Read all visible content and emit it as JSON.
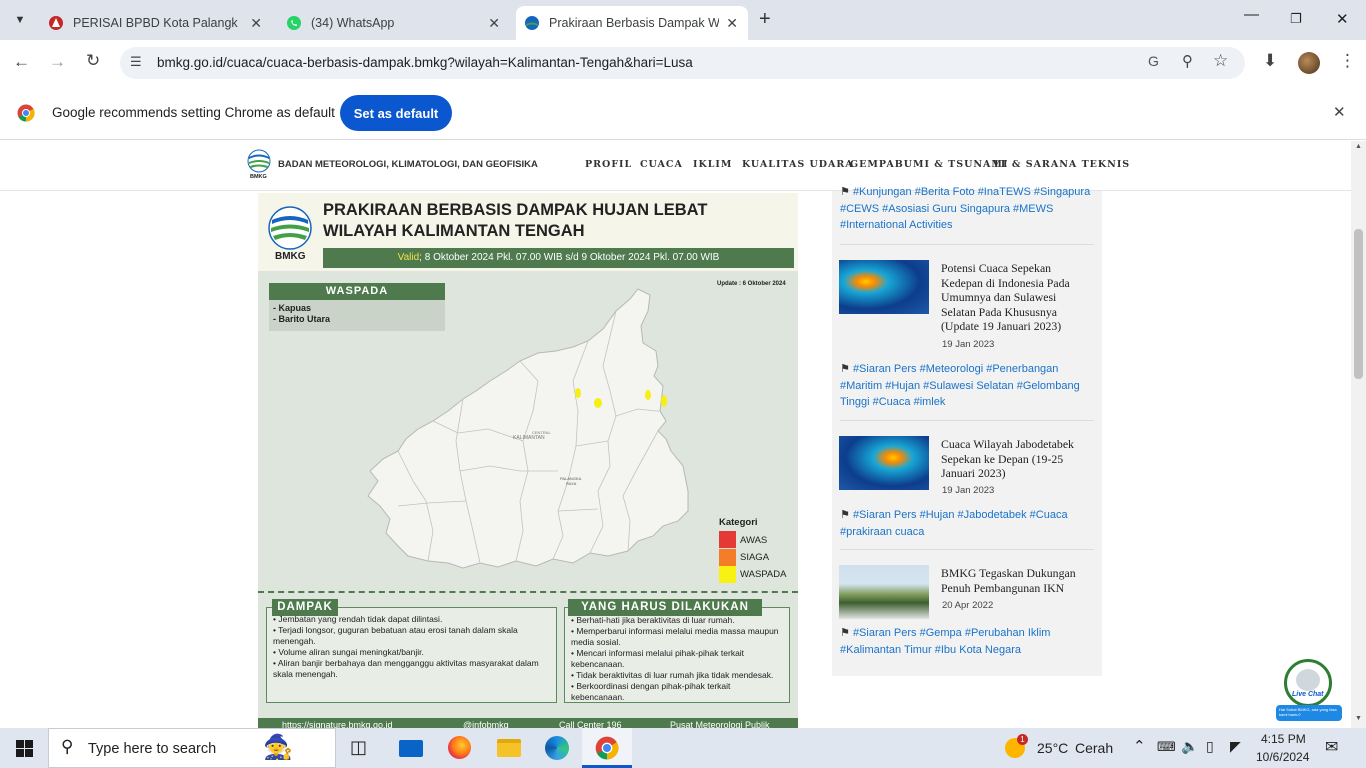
{
  "browser": {
    "tabs": [
      {
        "title": "PERISAI BPBD Kota Palangka Raya",
        "icon": "perisai-icon"
      },
      {
        "title": "(34) WhatsApp",
        "icon": "whatsapp-icon"
      },
      {
        "title": "Prakiraan Berbasis Dampak Wilayah",
        "icon": "bmkg-icon"
      }
    ],
    "new_tab": "+",
    "url": "bmkg.go.id/cuaca/cuaca-berbasis-dampak.bmkg?wilayah=Kalimantan-Tengah&hari=Lusa",
    "infobar_text": "Google recommends setting Chrome as default",
    "set_default_label": "Set as default"
  },
  "site": {
    "org_name": "BADAN METEOROLOGI, KLIMATOLOGI, DAN GEOFISIKA",
    "logo_text": "BMKG",
    "nav": [
      "PROFIL",
      "CUACA",
      "IKLIM",
      "KUALITAS UDARA",
      "GEMPABUMI & TSUNAMI",
      "IT & SARANA TEKNIS"
    ]
  },
  "infographic": {
    "title_line1": "PRAKIRAAN BERBASIS DAMPAK HUJAN LEBAT",
    "title_line2": "WILAYAH KALIMANTAN TENGAH",
    "valid_label": "Valid",
    "valid_text": "; 8 Oktober 2024 Pkl. 07.00 WIB s/d 9 Oktober 2024 Pkl. 07.00 WIB",
    "update": "Update : 6 Oktober 2024",
    "waspada_title": "WASPADA",
    "waspada_areas": [
      "- Kapuas",
      "- Barito Utara"
    ],
    "map_label_1": "CENTRAL",
    "map_label_2": "KALIMANTAN",
    "map_city_1": "PALANGKA",
    "map_city_2": "RAYA",
    "legend_title": "Kategori",
    "legend": [
      {
        "label": "AWAS",
        "color": "#e53935"
      },
      {
        "label": "SIAGA",
        "color": "#f57c28"
      },
      {
        "label": "WASPADA",
        "color": "#f7f214"
      }
    ],
    "dampak_title": "DAMPAK",
    "dampak_items": [
      "• Jembatan yang rendah tidak dapat dilintasi.",
      "• Terjadi longsor, guguran bebatuan atau erosi tanah dalam skala menengah.",
      "• Volume aliran sungai meningkat/banjir.",
      "• Aliran banjir berbahaya dan mengganggu aktivitas masyarakat dalam skala menengah."
    ],
    "todo_title": "YANG HARUS DILAKUKAN",
    "todo_items": [
      "• Berhati-hati jika beraktivitas di luar rumah.",
      "• Memperbarui informasi melalui media massa maupun media sosial.",
      "• Mencari informasi melalui pihak-pihak terkait kebencanaan.",
      "• Tidak beraktivitas di luar rumah jika tidak mendesak.",
      "• Berkoordinasi dengan pihak-pihak terkait kebencanaan."
    ],
    "footer": [
      "https://signature.bmkg.go.id",
      "@infobmkg",
      "Call Center 196",
      "Pusat Meteorologi Publik"
    ]
  },
  "sidebar": {
    "top_tags": "#Kunjungan #Berita Foto #InaTEWS #Singapura #CEWS #Asosiasi Guru Singapura #MEWS #International Activities",
    "articles": [
      {
        "title": "Potensi Cuaca Sepekan Kedepan di Indonesia Pada Umumnya dan Sulawesi Selatan Pada Khususnya (Update 19 Januari 2023)",
        "date": "19 Jan 2023",
        "tags": "#Siaran Pers #Meteorologi #Penerbangan #Maritim #Hujan #Sulawesi Selatan #Gelombang Tinggi #Cuaca #imlek"
      },
      {
        "title": "Cuaca Wilayah Jabodetabek Sepekan ke Depan (19-25 Januari 2023)",
        "date": "19 Jan 2023",
        "tags": "#Siaran Pers #Hujan #Jabodetabek #Cuaca #prakiraan cuaca"
      },
      {
        "title": "BMKG Tegaskan Dukungan Penuh Pembangunan IKN",
        "date": "20 Apr 2022",
        "tags": "#Siaran Pers #Gempa #Perubahan Iklim #Kalimantan Timur #Ibu Kota Negara"
      }
    ]
  },
  "livechat": {
    "label": "Live Chat",
    "bubble": "Hai Sobat BMKG, ada yang bisa kami bantu?"
  },
  "taskbar": {
    "search_placeholder": "Type here to search",
    "weather_temp": "25°C",
    "weather_text": "Cerah",
    "time": "4:15 PM",
    "date": "10/6/2024",
    "notif_count": "1"
  }
}
